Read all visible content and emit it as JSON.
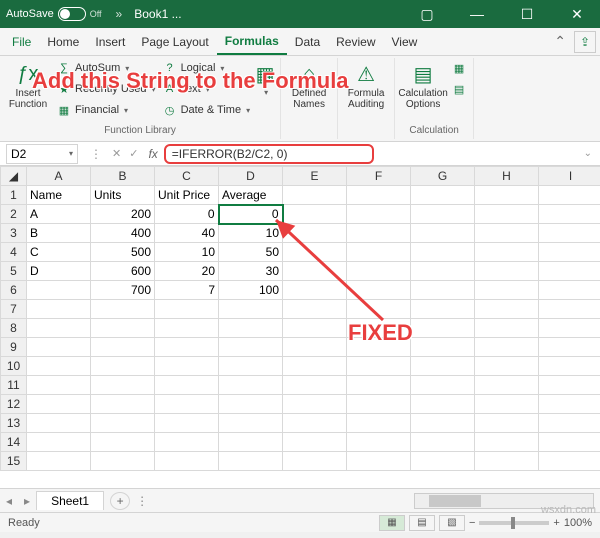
{
  "title": {
    "autosave": "AutoSave",
    "autosave_state": "Off",
    "book": "Book1 ..."
  },
  "tabs": {
    "file": "File",
    "home": "Home",
    "insert": "Insert",
    "pagelayout": "Page Layout",
    "formulas": "Formulas",
    "data": "Data",
    "review": "Review",
    "view": "View"
  },
  "ribbon": {
    "insert_function": "Insert\nFunction",
    "autosum": "AutoSum",
    "recent": "Recently Used",
    "financial": "Financial",
    "logical": "Logical",
    "text": "Text",
    "datetime": "Date & Time",
    "defined_names": "Defined\nNames",
    "formula_auditing": "Formula\nAuditing",
    "calc_options": "Calculation\nOptions",
    "group_lib": "Function Library",
    "group_calc": "Calculation"
  },
  "namebox": "D2",
  "formula": "=IFERROR(B2/C2, 0)",
  "headers": [
    "A",
    "B",
    "C",
    "D",
    "E",
    "F",
    "G",
    "H",
    "I"
  ],
  "rows": [
    {
      "n": 1,
      "a": "Name",
      "b": "Units",
      "c": "Unit Price",
      "d": "Average"
    },
    {
      "n": 2,
      "a": "A",
      "b": "200",
      "c": "0",
      "d": "0"
    },
    {
      "n": 3,
      "a": "B",
      "b": "400",
      "c": "40",
      "d": "10"
    },
    {
      "n": 4,
      "a": "C",
      "b": "500",
      "c": "10",
      "d": "50"
    },
    {
      "n": 5,
      "a": "D",
      "b": "600",
      "c": "20",
      "d": "30"
    },
    {
      "n": 6,
      "a": "",
      "b": "700",
      "c": "7",
      "d": "100"
    },
    {
      "n": 7
    },
    {
      "n": 8
    },
    {
      "n": 9
    },
    {
      "n": 10
    },
    {
      "n": 11
    },
    {
      "n": 12
    },
    {
      "n": 13
    },
    {
      "n": 14
    },
    {
      "n": 15
    }
  ],
  "sheet": "Sheet1",
  "status": "Ready",
  "zoom": "100%",
  "annot1": "Add this String to the Formula",
  "annot2": "FIXED",
  "watermark": "wsxdn.com"
}
